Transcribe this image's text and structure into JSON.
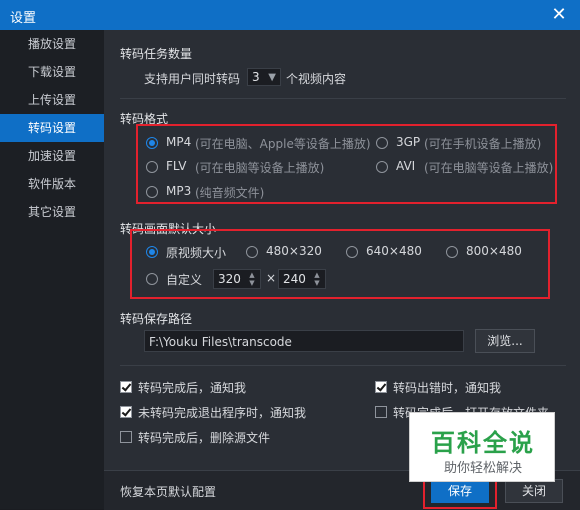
{
  "window": {
    "title": "设置",
    "close": "✕"
  },
  "sidebar": {
    "items": [
      {
        "label": "播放设置",
        "active": false
      },
      {
        "label": "下载设置",
        "active": false
      },
      {
        "label": "上传设置",
        "active": false
      },
      {
        "label": "转码设置",
        "active": true
      },
      {
        "label": "加速设置",
        "active": false
      },
      {
        "label": "软件版本",
        "active": false
      },
      {
        "label": "其它设置",
        "active": false
      }
    ]
  },
  "task": {
    "title": "转码任务数量",
    "prefix": "支持用户同时转码",
    "value": "3",
    "suffix": "个视频内容"
  },
  "format": {
    "title": "转码格式",
    "options": [
      {
        "name": "MP4",
        "desc": "(可在电脑、Apple等设备上播放)",
        "selected": true
      },
      {
        "name": "3GP",
        "desc": "(可在手机设备上播放)",
        "selected": false
      },
      {
        "name": "FLV",
        "desc": "(可在电脑等设备上播放)",
        "selected": false
      },
      {
        "name": "AVI",
        "desc": "(可在电脑等设备上播放)",
        "selected": false
      },
      {
        "name": "MP3",
        "desc": "(纯音频文件)",
        "selected": false
      }
    ]
  },
  "size": {
    "title": "转码画面默认大小",
    "options": [
      {
        "label": "原视频大小",
        "selected": true
      },
      {
        "label": "480×320",
        "selected": false
      },
      {
        "label": "640×480",
        "selected": false
      },
      {
        "label": "800×480",
        "selected": false
      },
      {
        "label": "自定义",
        "selected": false
      }
    ],
    "custom_width": "320",
    "custom_height": "240",
    "times": "×"
  },
  "save_path": {
    "title": "转码保存路径",
    "value": "F:\\Youku Files\\transcode",
    "browse": "浏览..."
  },
  "checks": [
    {
      "label": "转码完成后，通知我",
      "checked": true
    },
    {
      "label": "转码出错时，通知我",
      "checked": true
    },
    {
      "label": "未转码完成退出程序时，通知我",
      "checked": true
    },
    {
      "label": "转码完成后，打开存放文件夹",
      "checked": false
    },
    {
      "label": "转码完成后，删除源文件",
      "checked": false
    }
  ],
  "footer": {
    "restore": "恢复本页默认配置",
    "save": "保存",
    "close": "关闭"
  },
  "watermark": {
    "main": "百科全说",
    "sub": "助你轻松解决"
  },
  "colors": {
    "accent": "#0f6fc6",
    "highlight_box": "#e3212d",
    "watermark_green": "#2aa14a"
  }
}
